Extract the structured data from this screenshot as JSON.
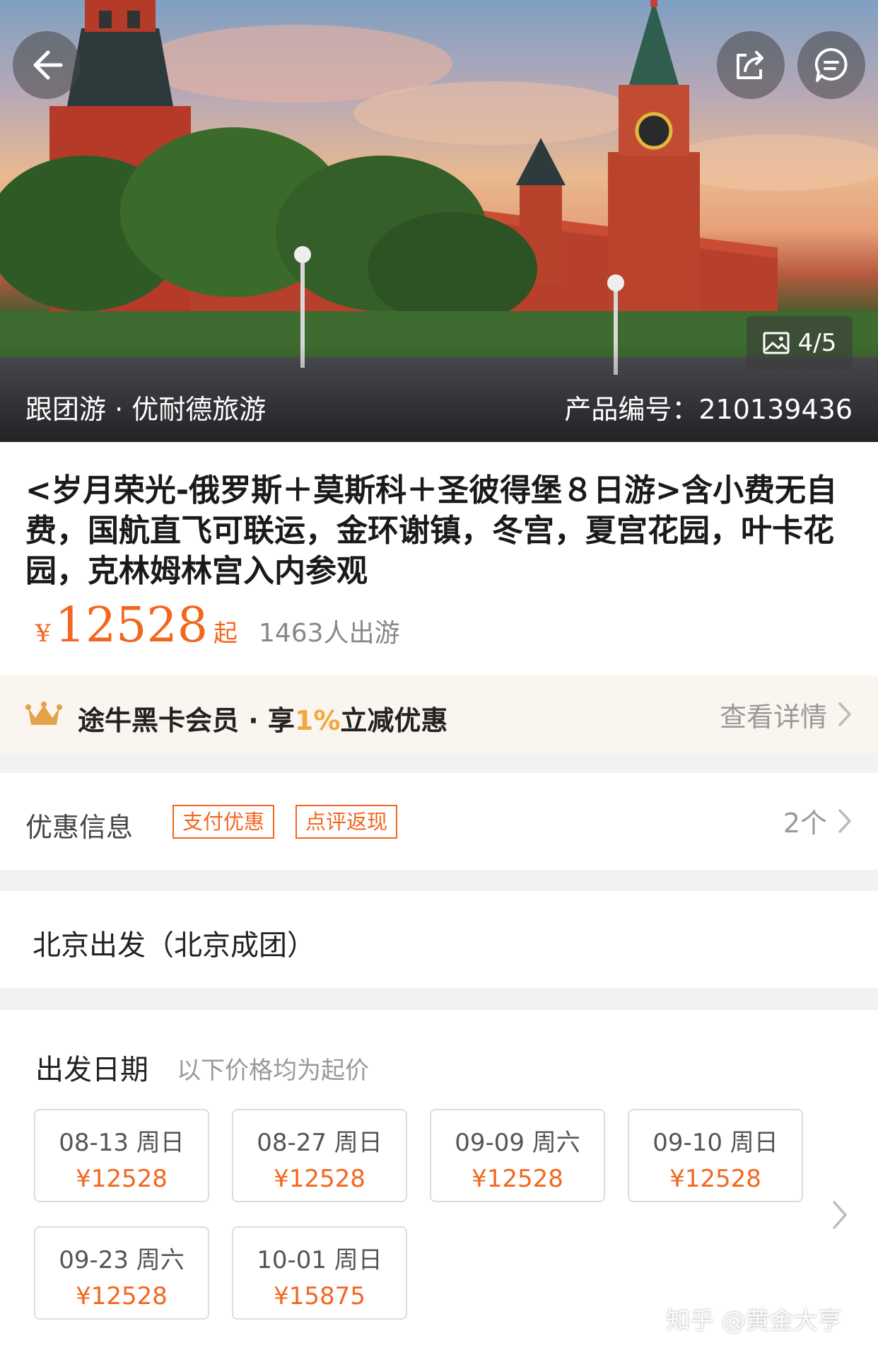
{
  "hero": {
    "image_counter": "4/5",
    "tour_type_label": "跟团游 · 优耐德旅游",
    "product_code_label": "产品编号：210139436"
  },
  "product": {
    "title": "<岁月荣光-俄罗斯＋莫斯科＋圣彼得堡８日游>含小费无自费，国航直飞可联运，金环谢镇，冬宫，夏宫花园，叶卡花园，克林姆林宫入内参观",
    "currency": "¥",
    "price": "12528",
    "price_suffix": "起",
    "travelers": "1463人出游"
  },
  "member": {
    "prefix": "途牛黑卡会员 · 享",
    "percent": "1%",
    "suffix": "立减优惠",
    "link": "查看详情"
  },
  "promo": {
    "label": "优惠信息",
    "tags": [
      "支付优惠",
      "点评返现"
    ],
    "count": "2个"
  },
  "departure": {
    "label": "北京出发（北京成团）"
  },
  "dates": {
    "title": "出发日期",
    "subtitle": "以下价格均为起价",
    "items": [
      {
        "date": "08-13 周日",
        "price": "¥12528"
      },
      {
        "date": "08-27 周日",
        "price": "¥12528"
      },
      {
        "date": "09-09 周六",
        "price": "¥12528"
      },
      {
        "date": "09-10 周日",
        "price": "¥12528"
      },
      {
        "date": "09-23 周六",
        "price": "¥12528"
      },
      {
        "date": "10-01 周日",
        "price": "¥15875"
      }
    ]
  },
  "watermark": "知乎 @黄金大亨",
  "colors": {
    "accent": "#f2671f",
    "member_bg": "#faf5ef",
    "gold": "#f2a93b"
  }
}
